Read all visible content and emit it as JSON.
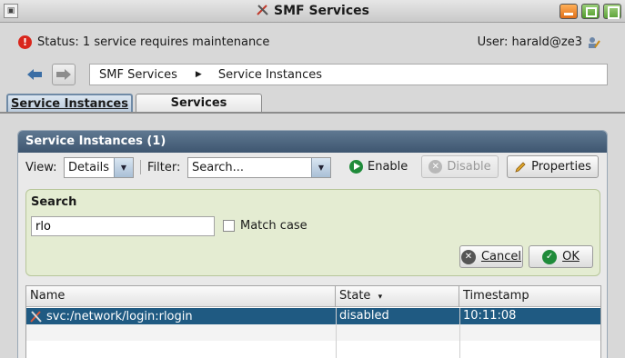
{
  "window": {
    "title": "SMF Services",
    "menu_glyph": "▣"
  },
  "status": {
    "text": "Status: 1 service requires maintenance",
    "user": "User: harald@ze3"
  },
  "nav": {
    "breadcrumb": [
      "SMF Services",
      "Service Instances"
    ],
    "separator": "▶"
  },
  "tabs": [
    {
      "label": "Service Instances",
      "selected": true
    },
    {
      "label": "Services",
      "selected": false
    }
  ],
  "panel": {
    "title": "Service Instances (1)",
    "toolbar": {
      "view_label": "View:",
      "view_value": "Details",
      "filter_label": "Filter:",
      "filter_value": "Search...",
      "enable_label": "Enable",
      "disable_label": "Disable",
      "properties_label": "Properties"
    },
    "search": {
      "title": "Search",
      "value": "rlo",
      "match_case_label": "Match case",
      "match_case_checked": false,
      "cancel_label": "Cancel",
      "ok_label": "OK"
    },
    "table": {
      "columns": [
        "Name",
        "State",
        "Timestamp"
      ],
      "sort_indicator": "▾",
      "rows": [
        {
          "name": "svc:/network/login:rlogin",
          "state": "disabled",
          "timestamp": "10:11:08",
          "selected": true
        }
      ]
    }
  },
  "colors": {
    "panel_header": "#4e6780",
    "selection": "#1f5a82",
    "search_bg": "#e4ecd2",
    "enable_green": "#1f8b3a",
    "warning_red": "#d9261c"
  },
  "icons": [
    "menu-icon",
    "tools-icon",
    "minimize-icon",
    "maximize-icon",
    "close-icon",
    "warning-icon",
    "user-edit-icon",
    "back-arrow-icon",
    "forward-arrow-icon",
    "dropdown-arrow-icon",
    "enable-icon",
    "disable-icon",
    "pencil-icon",
    "cancel-icon",
    "ok-icon",
    "service-tools-icon"
  ]
}
